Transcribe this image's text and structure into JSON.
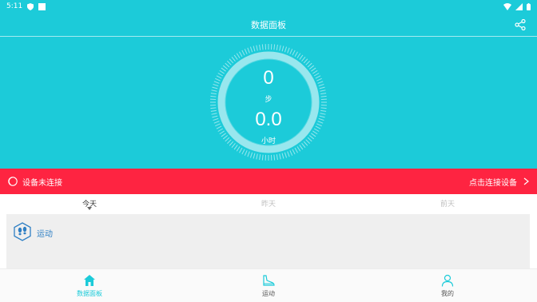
{
  "status_bar": {
    "time": "5:11"
  },
  "header": {
    "title": "数据面板"
  },
  "summary": {
    "steps": "0",
    "steps_unit": "步",
    "hours": "0.0",
    "hours_unit": "小时"
  },
  "alert": {
    "message": "设备未连接",
    "action": "点击连接设备"
  },
  "day_tabs": [
    {
      "label": "今天",
      "active": true
    },
    {
      "label": "昨天",
      "active": false
    },
    {
      "label": "前天",
      "active": false
    }
  ],
  "card": {
    "title": "运动"
  },
  "nav": [
    {
      "label": "数据面板",
      "active": true
    },
    {
      "label": "运动",
      "active": false
    },
    {
      "label": "我的",
      "active": false
    }
  ],
  "colors": {
    "primary": "#1ccbd9",
    "alert": "#fe2441",
    "card_title": "#2e7fc4"
  }
}
